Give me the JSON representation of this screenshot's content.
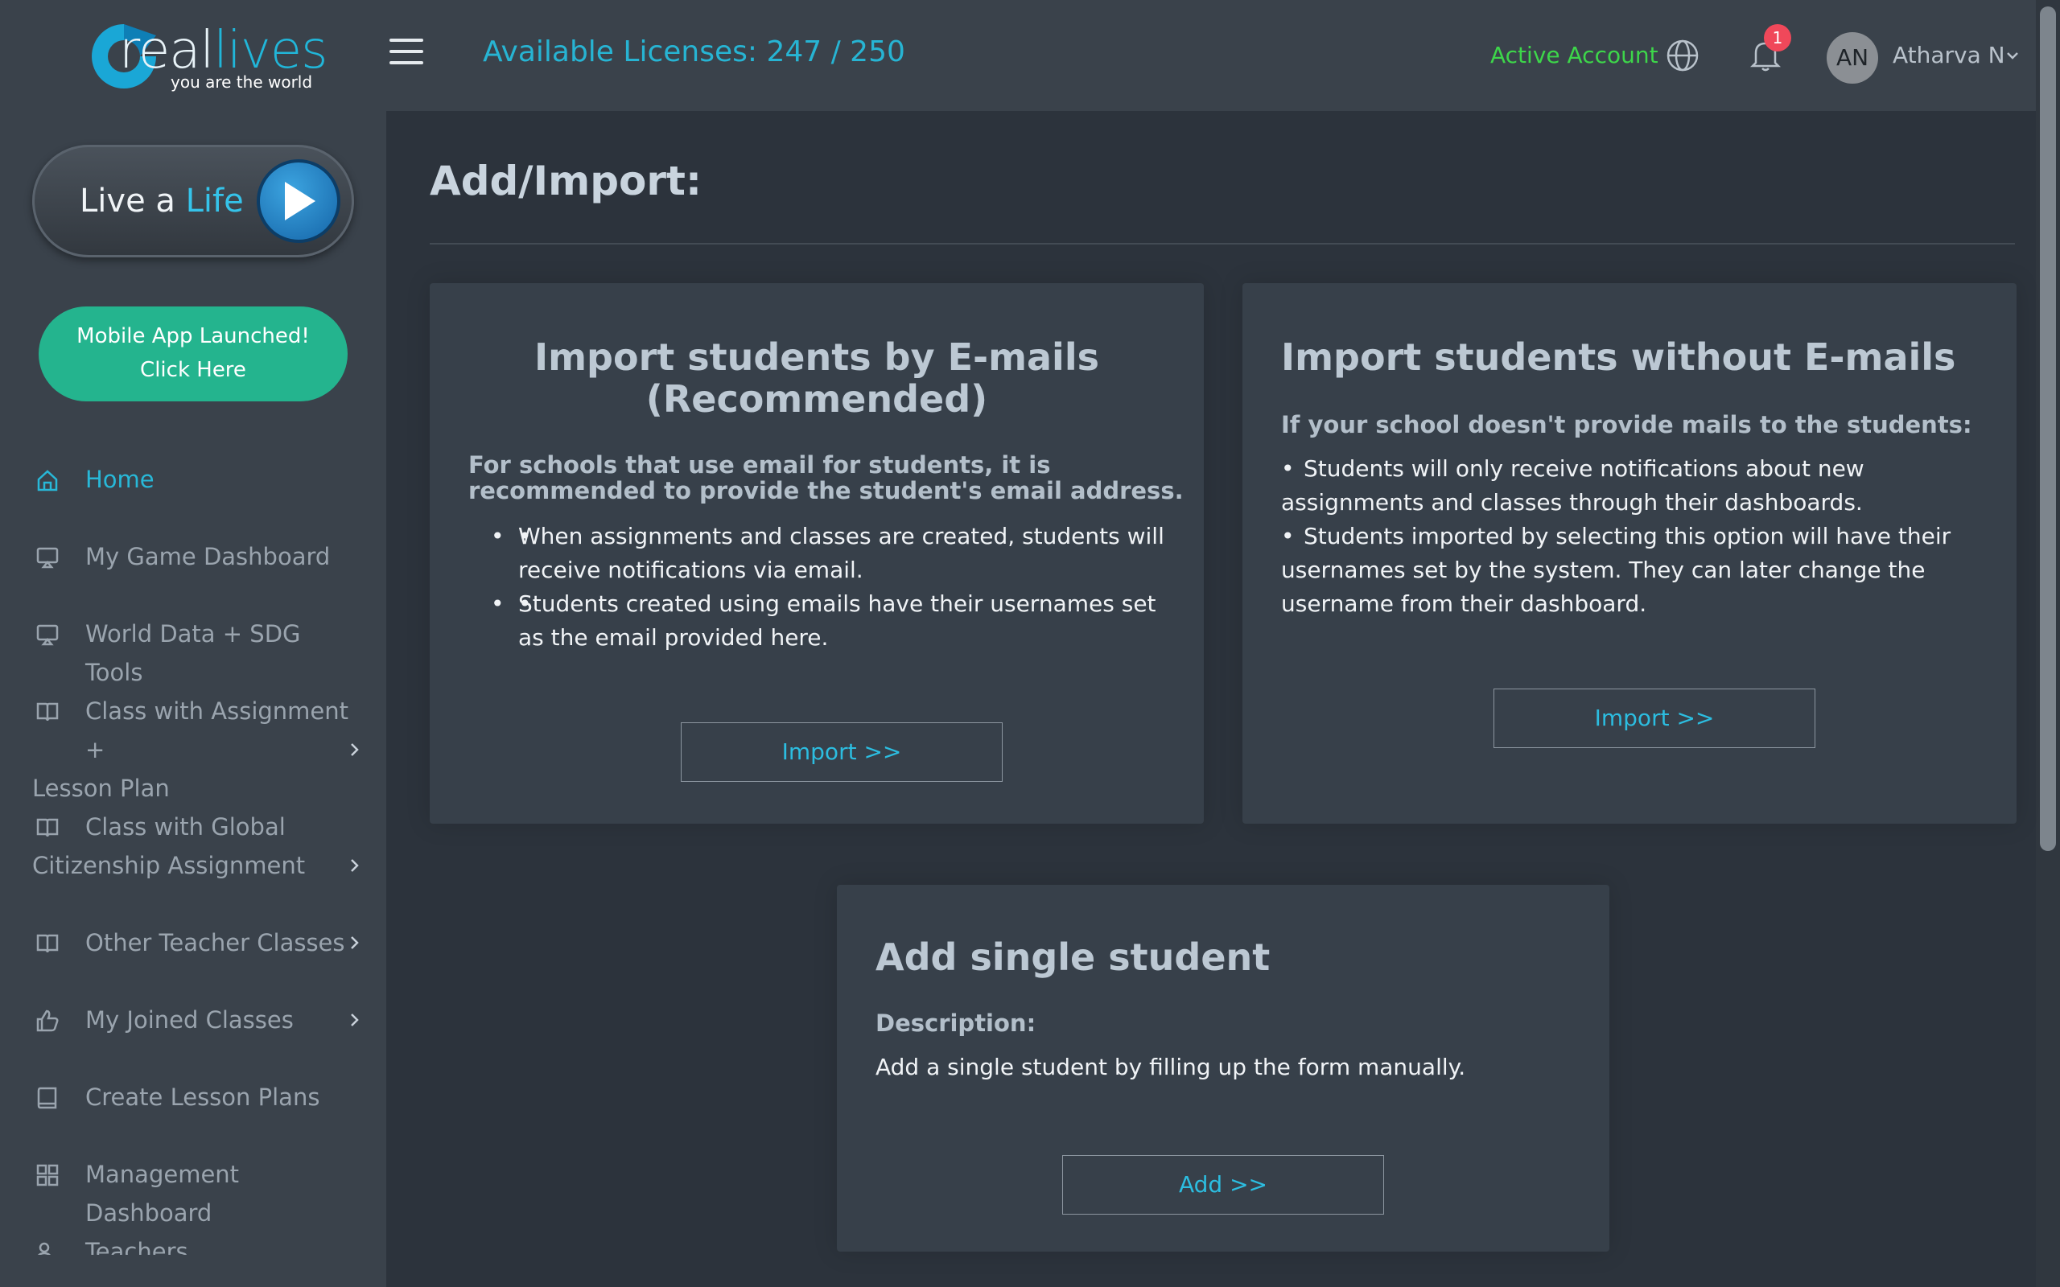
{
  "logo": {
    "brand_part1": "real",
    "brand_part2": "lives",
    "tagline": "you are the world"
  },
  "live_life": {
    "part1": "Live a ",
    "part2": "Life"
  },
  "mobile_app": {
    "line1": "Mobile App Launched!",
    "line2": "Click Here"
  },
  "nav": {
    "items": [
      {
        "line1": "Home",
        "line2": ""
      },
      {
        "line1": "My Game Dashboard",
        "line2": ""
      },
      {
        "line1": "World Data + SDG Tools",
        "line2": ""
      },
      {
        "line1": "Class with Assignment +",
        "line2": "Lesson Plan"
      },
      {
        "line1": "Class with Global",
        "line2": "Citizenship Assignment"
      },
      {
        "line1": "Other Teacher Classes",
        "line2": ""
      },
      {
        "line1": "My Joined Classes",
        "line2": ""
      },
      {
        "line1": "Create Lesson Plans",
        "line2": ""
      },
      {
        "line1": "Management Dashboard",
        "line2": ""
      },
      {
        "line1": "Teachers",
        "line2": ""
      }
    ]
  },
  "header": {
    "licenses": "Available Licenses: 247 / 250",
    "active_account": "Active Account",
    "notification_count": "1",
    "avatar_initials": "AN",
    "user_name": "Atharva N"
  },
  "main": {
    "title": "Add/Import:",
    "card_email": {
      "title_line1": "Import students by E-mails",
      "title_line2": "(Recommended)",
      "subtitle": "For schools that use email for students, it is recommended to provide the student's email address.",
      "bullets": [
        "When assignments and classes are created, students will receive notifications via email.",
        "Students created using emails have their usernames set as the email provided here."
      ],
      "button": "Import >>"
    },
    "card_no_email": {
      "title": "Import students without E-mails",
      "subtitle": "If your school doesn't provide mails to the students:",
      "bullets": [
        "Students will only receive notifications about new assignments and classes through their dashboards.",
        "Students imported by selecting this option will have their usernames set by the system. They can later change the username from their dashboard."
      ],
      "button": "Import >>"
    },
    "card_single": {
      "title": "Add single student",
      "desc_label": "Description:",
      "desc_text": "Add a single student by filling up the form manually.",
      "button": "Add >>"
    }
  },
  "colors": {
    "accent_cyan": "#27b4d3",
    "active_green": "#3dd64a",
    "mobile_button": "#24b48e",
    "badge_red": "#f0485a"
  }
}
